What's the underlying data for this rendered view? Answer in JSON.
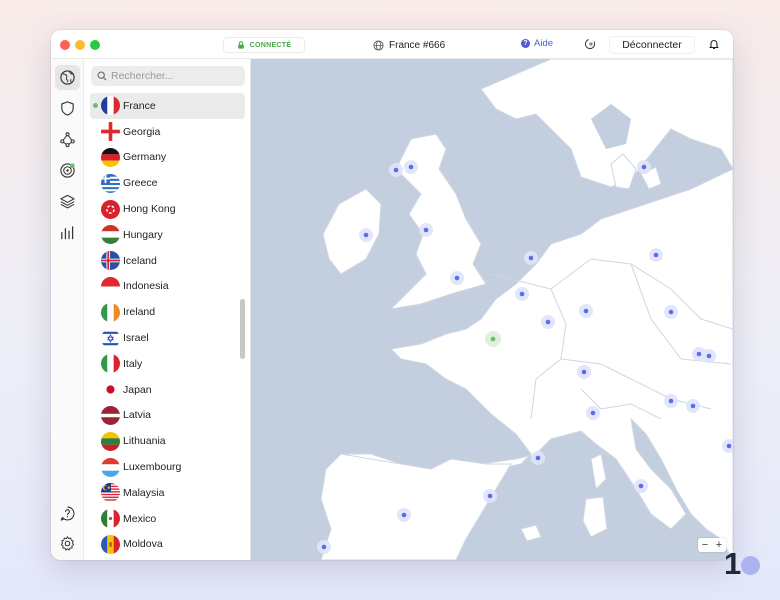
{
  "titlebar": {
    "status": "CONNECTÉ",
    "server": "France #666",
    "help": "Aide",
    "disconnect": "Déconnecter"
  },
  "search": {
    "placeholder": "Rechercher..."
  },
  "countries": [
    {
      "name": "France",
      "selected": true,
      "connected": true
    },
    {
      "name": "Georgia"
    },
    {
      "name": "Germany"
    },
    {
      "name": "Greece"
    },
    {
      "name": "Hong Kong"
    },
    {
      "name": "Hungary"
    },
    {
      "name": "Iceland"
    },
    {
      "name": "Indonesia"
    },
    {
      "name": "Ireland"
    },
    {
      "name": "Israel"
    },
    {
      "name": "Italy"
    },
    {
      "name": "Japan"
    },
    {
      "name": "Latvia"
    },
    {
      "name": "Lithuania"
    },
    {
      "name": "Luxembourg"
    },
    {
      "name": "Malaysia"
    },
    {
      "name": "Mexico"
    },
    {
      "name": "Moldova"
    }
  ],
  "rail_icons": [
    "globe-icon",
    "shield-icon",
    "meshnet-icon",
    "threat-radar-icon",
    "layers-icon",
    "stats-icon",
    "help-icon",
    "settings-icon"
  ],
  "zoom": {
    "minus": "−",
    "plus": "+"
  },
  "colors": {
    "sea": "#c3cfdf",
    "land": "#ffffff",
    "border": "#d0d6e2",
    "server_pin": "#5b6bea",
    "connected_pin": "#6cc26c",
    "accent": "#4b5bd6"
  },
  "branding": {
    "logo_text": "1"
  }
}
